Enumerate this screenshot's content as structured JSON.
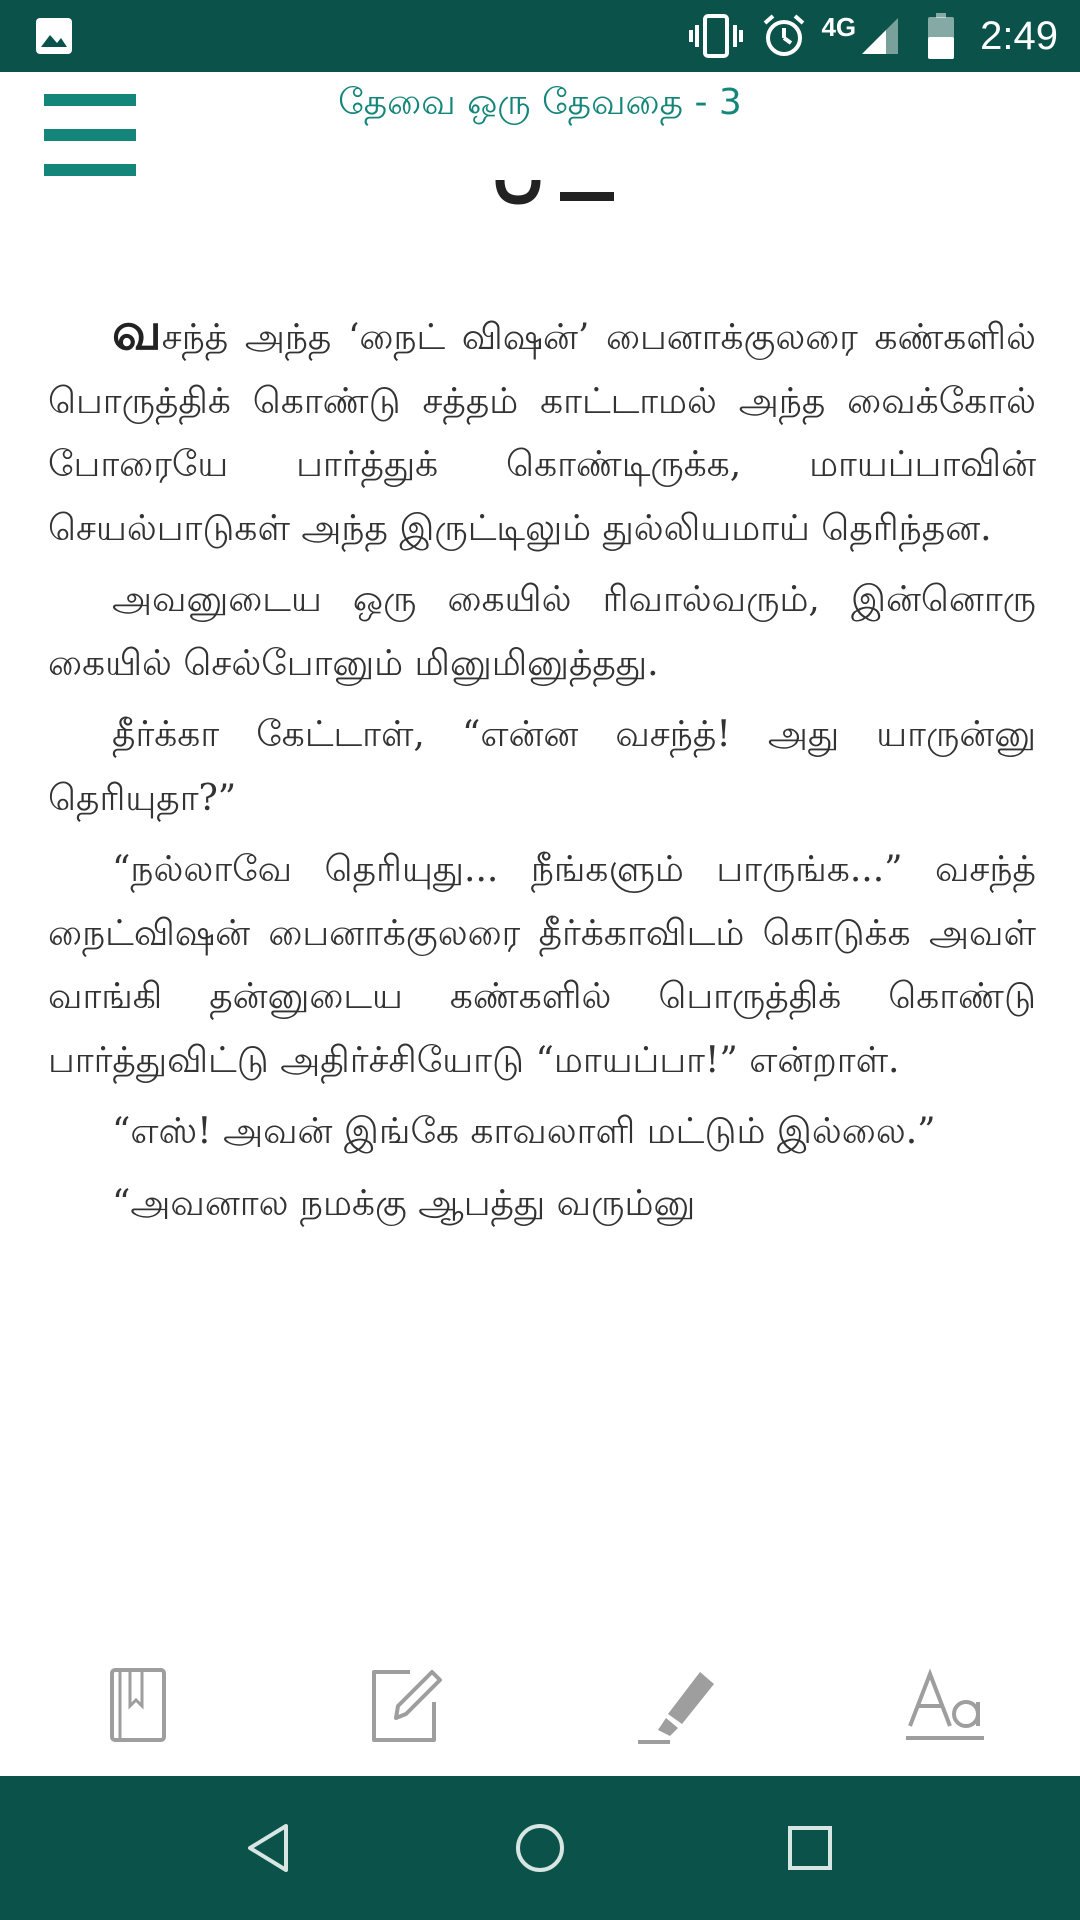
{
  "status_bar": {
    "network_type": "4G",
    "time": "2:49"
  },
  "header": {
    "title": "தேவை ஒரு தேவதை - 3"
  },
  "article": {
    "drop_letter": "வ",
    "paragraphs": [
      "சந்த் அந்த ‘நைட் விஷன்’ பைனாக்குலரை கண்களில் பொருத்திக் கொண்டு சத்தம் காட்டாமல் அந்த வைக்கோல் போரையே பார்த்துக் கொண்டிருக்க, மாயப்பாவின் செயல்பாடுகள் அந்த இருட்டிலும் துல்லியமாய் தெரிந்தன.",
      "அவனுடைய ஒரு கையில் ரிவால்வரும், இன்னொரு கையில் செல்போனும் மினுமினுத்தது.",
      "தீர்க்கா கேட்டாள், “என்ன வசந்த்! அது யாருன்னு தெரியுதா?”",
      "“நல்லாவே தெரியுது... நீங்களும் பாருங்க...” வசந்த் நைட்விஷன் பைனாக்குலரை தீர்க்காவிடம் கொடுக்க அவள் வாங்கி தன்னுடைய கண்களில் பொருத்திக் கொண்டு பார்த்துவிட்டு அதிர்ச்சியோடு “மாயப்பா!” என்றாள்.",
      "“எஸ்! அவன் இங்கே காவலாளி மட்டும் இல்லை.”",
      "“அவனால நமக்கு ஆபத்து வரும்னு"
    ]
  },
  "toolbar": {
    "items": [
      "bookmark-book-icon",
      "edit-note-icon",
      "highlighter-icon",
      "font-size-icon"
    ]
  },
  "navigation": {
    "items": [
      "back-triangle-icon",
      "home-circle-icon",
      "recents-square-icon"
    ]
  },
  "colors": {
    "bar": "#0b524a",
    "accent": "#14857a",
    "text": "#333333",
    "toolbar_icon": "#9e9e9e"
  }
}
